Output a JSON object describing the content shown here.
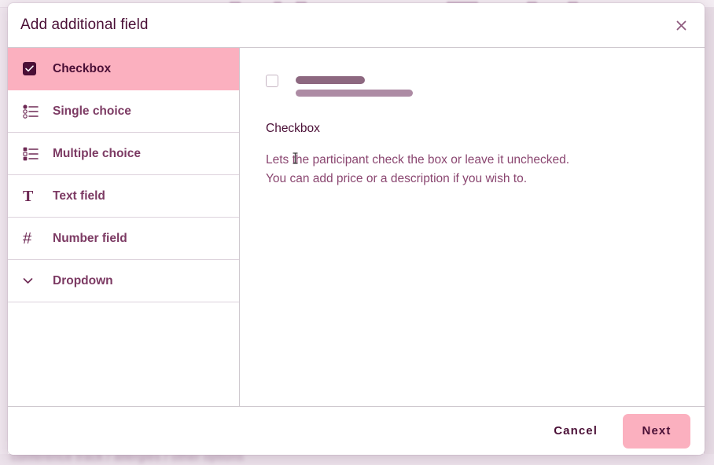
{
  "background": {
    "bottom_text": "conference track / allergies / other options"
  },
  "modal": {
    "title": "Add additional field",
    "close_icon": "close-icon",
    "sidebar": {
      "items": [
        {
          "label": "Checkbox",
          "icon": "checkbox-icon",
          "selected": true
        },
        {
          "label": "Single choice",
          "icon": "radio-list-icon",
          "selected": false
        },
        {
          "label": "Multiple choice",
          "icon": "checkbox-list-icon",
          "selected": false
        },
        {
          "label": "Text field",
          "icon": "text-field-icon",
          "selected": false
        },
        {
          "label": "Number field",
          "icon": "number-field-icon",
          "selected": false
        },
        {
          "label": "Dropdown",
          "icon": "chevron-down-icon",
          "selected": false
        }
      ]
    },
    "preview": {
      "checkbox_checked": false,
      "heading": "Checkbox",
      "description_line1": "Lets the participant check the box or leave it unchecked.",
      "description_line2": "You can add price or a description if you wish to."
    },
    "footer": {
      "cancel_label": "Cancel",
      "next_label": "Next"
    }
  },
  "colors": {
    "accent_pink": "#fbb0bf",
    "text_plum": "#4a0f36",
    "label_plum": "#7c3a63",
    "muted_plum": "#8a4670"
  }
}
